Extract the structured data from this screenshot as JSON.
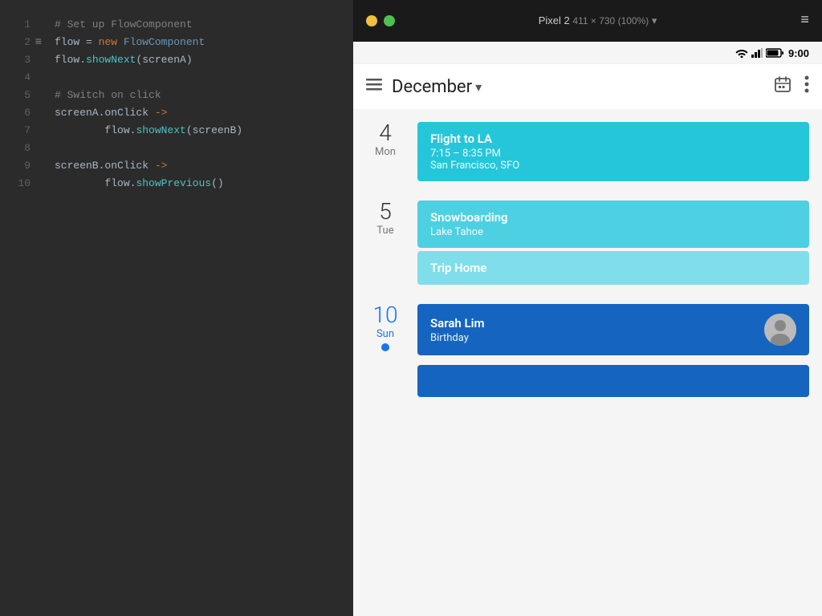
{
  "editor": {
    "lines": [
      {
        "num": 1,
        "icon": "",
        "tokens": [
          {
            "text": "# Set up FlowComponent",
            "cls": "c-comment"
          }
        ]
      },
      {
        "num": 2,
        "icon": "≡",
        "tokens": [
          {
            "text": "flow",
            "cls": "c-variable"
          },
          {
            "text": " = ",
            "cls": "c-variable"
          },
          {
            "text": "new ",
            "cls": "c-keyword"
          },
          {
            "text": "FlowComponent",
            "cls": "c-blue-var"
          }
        ]
      },
      {
        "num": 3,
        "icon": "",
        "tokens": [
          {
            "text": "flow",
            "cls": "c-variable"
          },
          {
            "text": ".",
            "cls": "c-variable"
          },
          {
            "text": "showNext",
            "cls": "c-cyan"
          },
          {
            "text": "(screenA)",
            "cls": "c-variable"
          }
        ]
      },
      {
        "num": 4,
        "icon": "",
        "tokens": []
      },
      {
        "num": 5,
        "icon": "",
        "tokens": [
          {
            "text": "# Switch on click",
            "cls": "c-comment"
          }
        ]
      },
      {
        "num": 6,
        "icon": "",
        "tokens": [
          {
            "text": "screenA",
            "cls": "c-variable"
          },
          {
            "text": ".onClick ",
            "cls": "c-variable"
          },
          {
            "text": "->",
            "cls": "c-arrow"
          }
        ]
      },
      {
        "num": 7,
        "icon": "",
        "tokens": [
          {
            "text": "        flow",
            "cls": "c-variable"
          },
          {
            "text": ".",
            "cls": "c-variable"
          },
          {
            "text": "showNext",
            "cls": "c-cyan"
          },
          {
            "text": "(screenB)",
            "cls": "c-variable"
          }
        ]
      },
      {
        "num": 8,
        "icon": "",
        "tokens": []
      },
      {
        "num": 9,
        "icon": "",
        "tokens": [
          {
            "text": "screenB",
            "cls": "c-variable"
          },
          {
            "text": ".onClick ",
            "cls": "c-variable"
          },
          {
            "text": "->",
            "cls": "c-arrow"
          }
        ]
      },
      {
        "num": 10,
        "icon": "",
        "tokens": [
          {
            "text": "        flow",
            "cls": "c-variable"
          },
          {
            "text": ".",
            "cls": "c-variable"
          },
          {
            "text": "showPrevious",
            "cls": "c-cyan"
          },
          {
            "text": "()",
            "cls": "c-variable"
          }
        ]
      }
    ]
  },
  "device": {
    "title": "Pixel 2",
    "dimensions": "411 × 730 (100%)",
    "dropdown_arrow": "▾",
    "menu_icon": "≡"
  },
  "status_bar": {
    "time": "9:00"
  },
  "toolbar": {
    "title": "December",
    "dropdown_arrow": "▾",
    "menu_icon": "☰",
    "calendar_icon": "📅",
    "more_icon": "⋮"
  },
  "calendar": {
    "days": [
      {
        "number": "4",
        "name": "Mon",
        "blue": false,
        "indicator": false,
        "events": [
          {
            "id": "flight-to-la",
            "title": "Flight to LA",
            "time": "7:15 – 8:35 PM",
            "location": "San Francisco, SFO",
            "color": "cyan-dark",
            "has_avatar": false
          }
        ]
      },
      {
        "number": "5",
        "name": "Tue",
        "blue": false,
        "indicator": false,
        "events": [
          {
            "id": "snowboarding",
            "title": "Snowboarding",
            "subtitle": "Lake Tahoe",
            "color": "cyan-medium",
            "has_avatar": false
          },
          {
            "id": "trip-home",
            "title": "Trip Home",
            "color": "cyan-light",
            "has_avatar": false
          }
        ]
      },
      {
        "number": "10",
        "name": "Sun",
        "blue": true,
        "indicator": true,
        "events": [
          {
            "id": "sarah-birthday",
            "title": "Sarah Lim",
            "subtitle": "Birthday",
            "color": "blue-dark",
            "has_avatar": true
          }
        ]
      }
    ]
  }
}
